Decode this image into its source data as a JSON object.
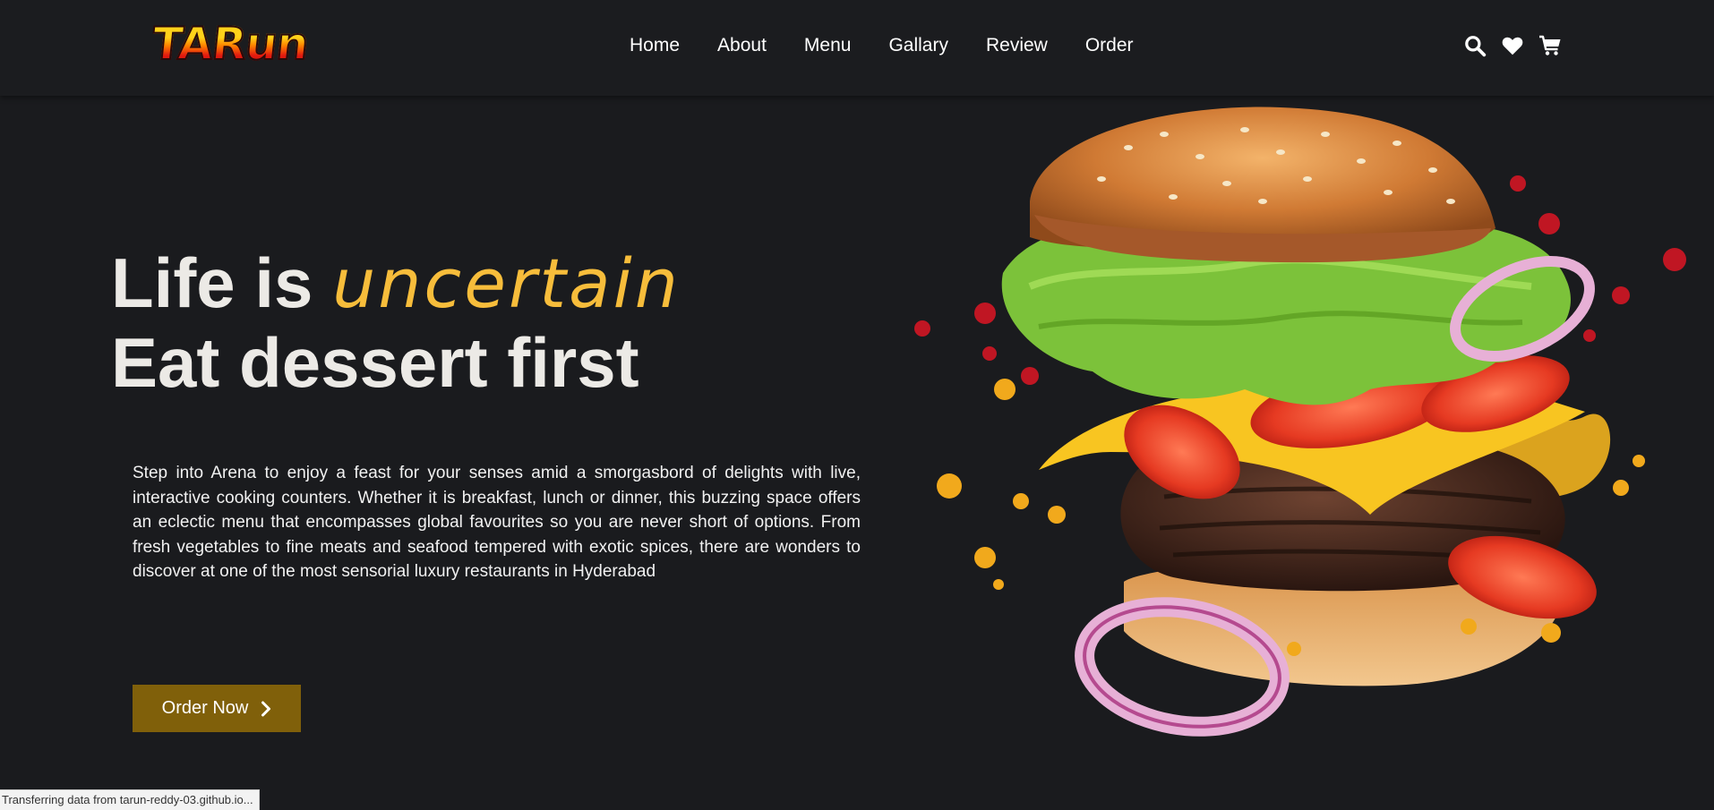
{
  "brand": {
    "logo_text": "TARun"
  },
  "nav": {
    "links": [
      {
        "label": "Home"
      },
      {
        "label": "About"
      },
      {
        "label": "Menu"
      },
      {
        "label": "Gallary"
      },
      {
        "label": "Review"
      },
      {
        "label": "Order"
      }
    ],
    "icons": [
      "search-icon",
      "heart-icon",
      "cart-icon"
    ]
  },
  "hero": {
    "title_line1_prefix": "Life is",
    "title_line1_accent": "uncertain",
    "title_line2": "Eat dessert first",
    "description": "Step into Arena to enjoy a feast for your senses amid a smorgasbord of delights with live, interactive cooking counters. Whether it is breakfast, lunch or dinner, this buzzing space offers an eclectic menu that encompasses global favourites so you are never short of options. From fresh vegetables to fine meats and seafood tempered with exotic spices, there are wonders to discover at one of the most sensorial luxury restaurants in Hyderabad",
    "cta_label": "Order Now",
    "cta_icon": "chevron-right-icon",
    "image": "burger-image"
  },
  "browser": {
    "status_text": "Transferring data from tarun-reddy-03.github.io..."
  },
  "colors": {
    "background": "#1a1b1e",
    "accent_text": "#f7bd3b",
    "button_bg": "#80600a",
    "title_text": "#eceae6"
  }
}
